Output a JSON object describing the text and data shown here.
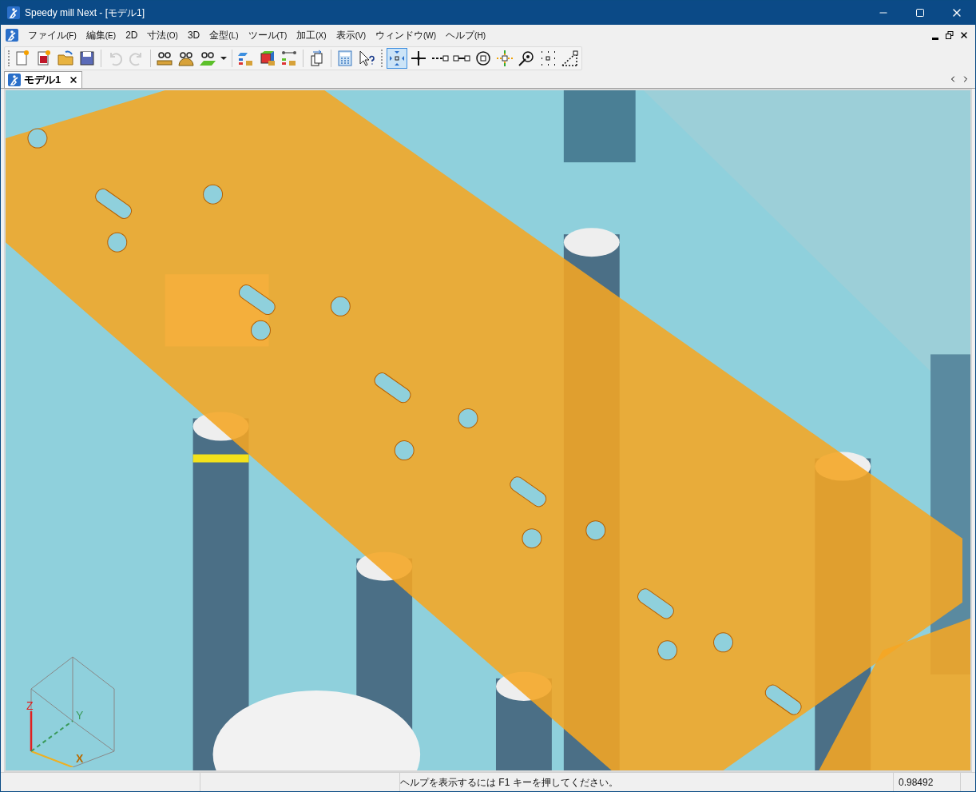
{
  "window": {
    "title": "Speedy mill Next - [モデル1]"
  },
  "menu": [
    {
      "label": "ファイル",
      "key": "(F)"
    },
    {
      "label": "編集",
      "key": "(E)"
    },
    {
      "label": "2D"
    },
    {
      "label": "寸法",
      "key": "(O)"
    },
    {
      "label": "3D"
    },
    {
      "label": "金型",
      "key": "(L)"
    },
    {
      "label": "ツール",
      "key": "(T)"
    },
    {
      "label": "加工",
      "key": "(X)"
    },
    {
      "label": "表示",
      "key": "(V)"
    },
    {
      "label": "ウィンドウ",
      "key": "(W)"
    },
    {
      "label": "ヘルプ",
      "key": "(H)"
    }
  ],
  "toolbar": [
    {
      "disabled": false,
      "selected": false
    },
    {
      "disabled": false,
      "selected": false
    },
    {
      "disabled": false,
      "selected": false
    },
    {
      "disabled": false,
      "selected": false
    },
    {
      "disabled": true,
      "selected": false
    },
    {
      "disabled": true,
      "selected": false
    },
    {
      "disabled": false,
      "selected": false
    },
    {
      "disabled": false,
      "selected": false
    },
    {
      "disabled": false,
      "selected": false
    },
    {
      "disabled": false,
      "selected": false
    },
    {
      "disabled": false,
      "selected": false
    },
    {
      "disabled": false,
      "selected": false
    },
    {
      "disabled": false,
      "selected": false
    },
    {
      "disabled": false,
      "selected": false
    },
    {
      "disabled": false,
      "selected": false
    },
    {
      "disabled": false,
      "selected": false
    },
    {
      "disabled": false,
      "selected": true
    },
    {
      "disabled": false,
      "selected": false
    },
    {
      "disabled": false,
      "selected": false
    },
    {
      "disabled": false,
      "selected": false
    },
    {
      "disabled": false,
      "selected": false
    },
    {
      "disabled": false,
      "selected": false
    },
    {
      "disabled": false,
      "selected": false
    },
    {
      "disabled": false,
      "selected": false
    },
    {
      "disabled": false,
      "selected": false
    }
  ],
  "tabs": [
    {
      "label": "モデル1",
      "selected": true
    }
  ],
  "axes": {
    "x": "X",
    "y": "Y",
    "z": "Z"
  },
  "status_bar": {
    "message": "ヘルプを表示するには F1 キーを押してください。",
    "value": "0.98492"
  }
}
